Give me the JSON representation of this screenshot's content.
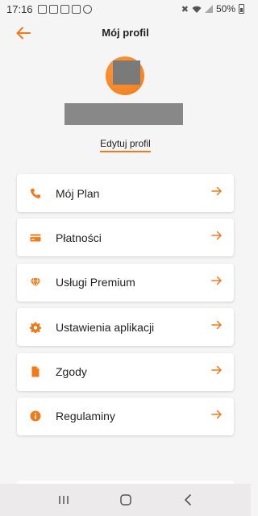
{
  "status_bar": {
    "time": "17:16",
    "battery": "50%"
  },
  "header": {
    "title": "Mój profil",
    "back_icon": "arrow-left-icon"
  },
  "profile": {
    "edit_label": "Edytuj profil"
  },
  "menu": [
    {
      "label": "Mój Plan",
      "icon": "phone-icon"
    },
    {
      "label": "Płatności",
      "icon": "credit-card-icon"
    },
    {
      "label": "Usługi Premium",
      "icon": "diamond-icon"
    },
    {
      "label": "Ustawienia aplikacji",
      "icon": "gear-icon"
    },
    {
      "label": "Zgody",
      "icon": "document-icon"
    },
    {
      "label": "Regulaminy",
      "icon": "info-icon"
    }
  ],
  "colors": {
    "accent": "#f07a1a",
    "background": "#f5f5f5",
    "card": "#ffffff"
  }
}
